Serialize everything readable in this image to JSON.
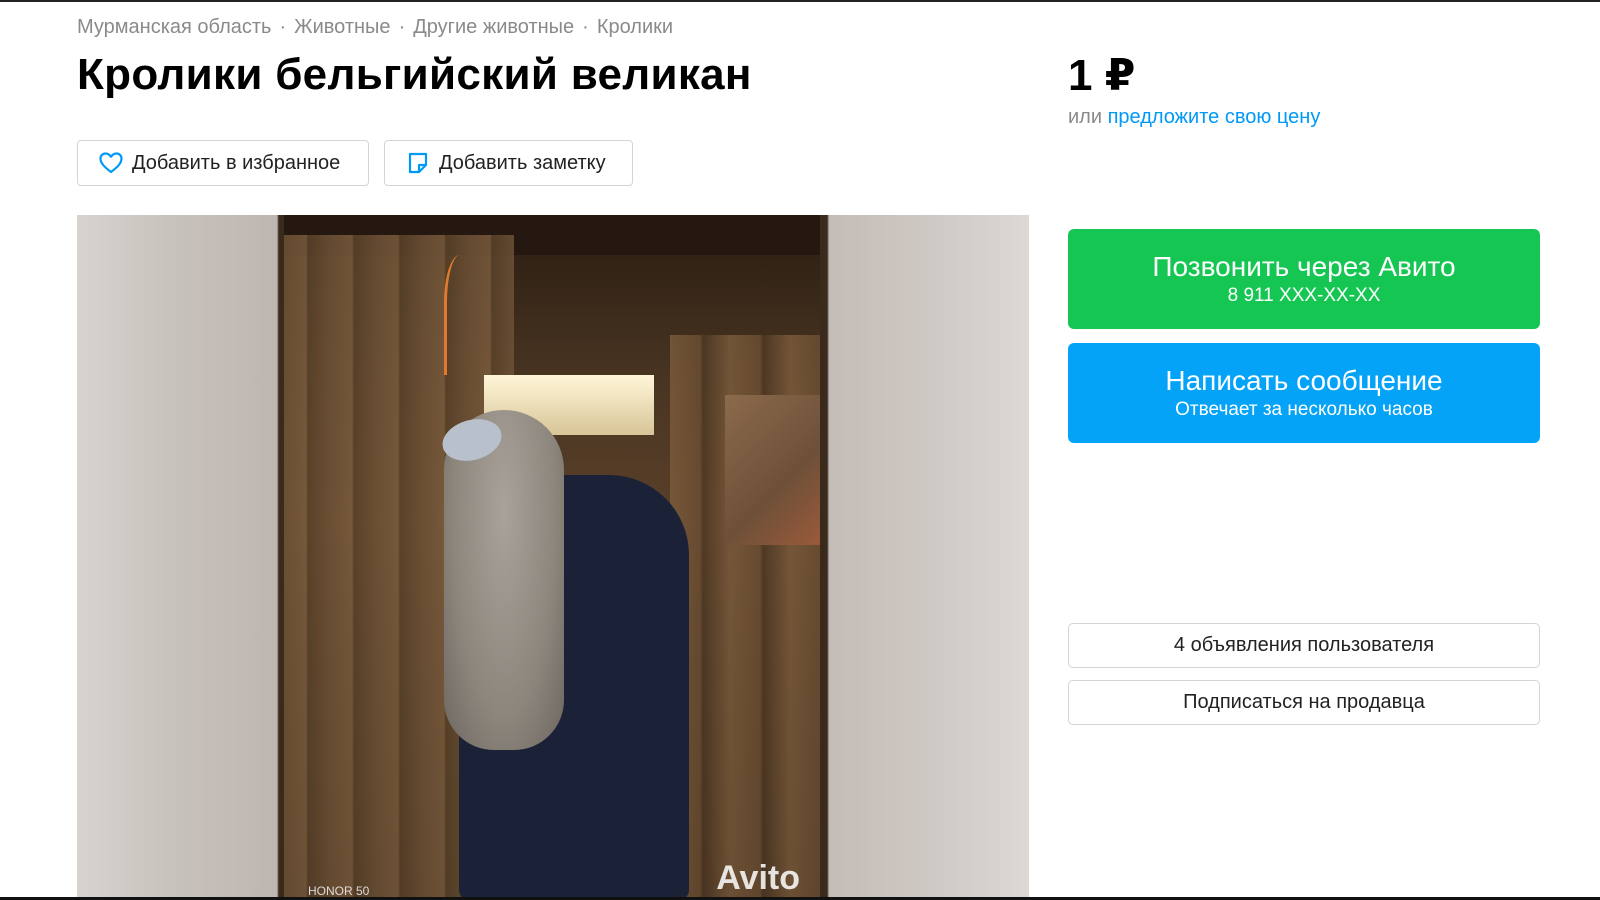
{
  "breadcrumb": {
    "items": [
      "Мурманская область",
      "Животные",
      "Другие животные",
      "Кролики"
    ],
    "separator": "·"
  },
  "title": "Кролики бельгийский великан",
  "actions": {
    "favorite_label": "Добавить в избранное",
    "note_label": "Добавить заметку"
  },
  "price": {
    "value": "1 ₽",
    "offer_prefix": "или",
    "offer_link": "предложите свою цену"
  },
  "contact": {
    "call_label": "Позвонить через Авито",
    "call_phone": "8 911 XXX-XX-XX",
    "message_label": "Написать сообщение",
    "message_sub": "Отвечает за несколько часов"
  },
  "seller": {
    "ads_label": "4 объявления пользователя",
    "subscribe_label": "Подписаться на продавца"
  },
  "photo": {
    "watermark": "Avito",
    "camera_tag": "HONOR 50"
  },
  "colors": {
    "call_green": "#16c653",
    "message_blue": "#04a3f8",
    "link_blue": "#0099f7",
    "muted_gray": "#8a8a8a"
  },
  "icons": [
    "heart-icon",
    "note-icon"
  ]
}
